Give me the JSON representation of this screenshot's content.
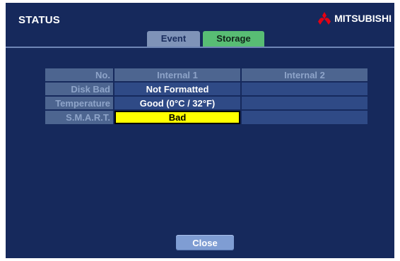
{
  "window": {
    "title": "STATUS"
  },
  "brand": {
    "name": "MITSUBISHI",
    "accent_color": "#e60012"
  },
  "tabs": [
    {
      "label": "Event",
      "selected": false
    },
    {
      "label": "Storage",
      "selected": true
    }
  ],
  "table": {
    "headers": [
      "No.",
      "Internal 1",
      "Internal 2"
    ],
    "rows": [
      {
        "label": "Disk Bad",
        "internal1": "Not Formatted",
        "internal2": ""
      },
      {
        "label": "Temperature",
        "internal1": "Good (0°C / 32°F)",
        "internal2": ""
      },
      {
        "label": "S.M.A.R.T.",
        "internal1": "Bad",
        "internal2": ""
      }
    ]
  },
  "footer": {
    "close_label": "Close"
  }
}
